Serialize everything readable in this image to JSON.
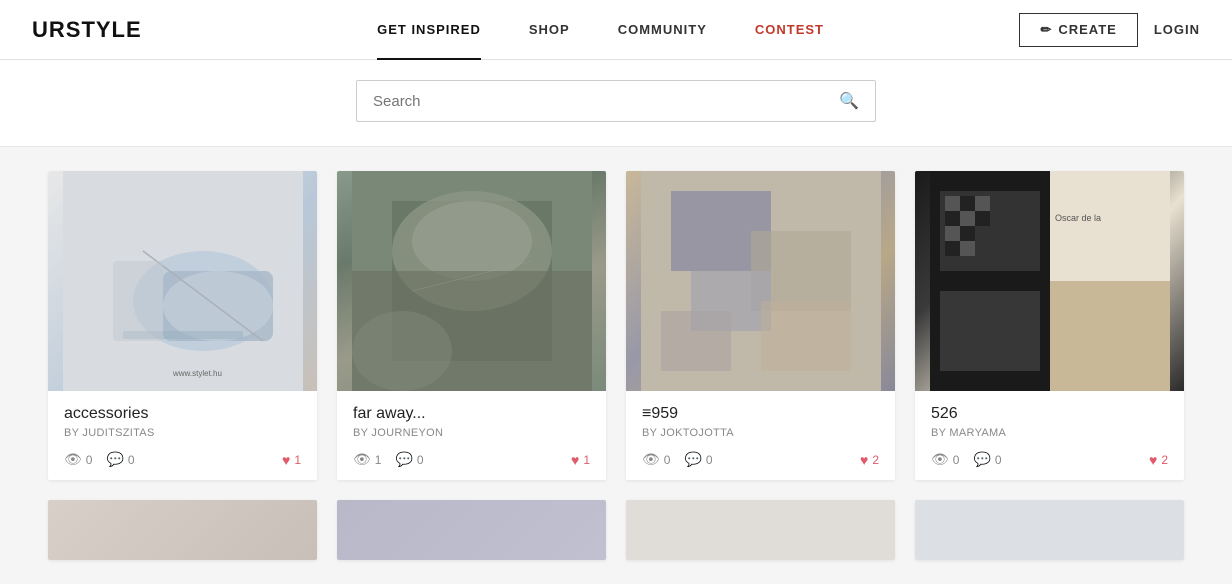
{
  "logo": "URSTYLE",
  "nav": {
    "items": [
      {
        "id": "get-inspired",
        "label": "GET INSPIRED",
        "active": true
      },
      {
        "id": "shop",
        "label": "SHOP",
        "active": false
      },
      {
        "id": "community",
        "label": "COMMUNITY",
        "active": false
      },
      {
        "id": "contest",
        "label": "CONTEST",
        "active": false,
        "highlight": true
      }
    ]
  },
  "header": {
    "create_label": "CREATE",
    "login_label": "LOGIN"
  },
  "search": {
    "placeholder": "Search"
  },
  "cards": [
    {
      "title": "accessories",
      "author": "by JUDITSZITAS",
      "views": "0",
      "comments": "0",
      "likes": "1",
      "img_class": "card-img-1"
    },
    {
      "title": "far away...",
      "author": "by JOURNEYON",
      "views": "1",
      "comments": "0",
      "likes": "1",
      "img_class": "card-img-2"
    },
    {
      "title": "≡959",
      "author": "by JOKTOJOTTA",
      "views": "0",
      "comments": "0",
      "likes": "2",
      "img_class": "card-img-3"
    },
    {
      "title": "526",
      "author": "by MARYAMA",
      "views": "0",
      "comments": "0",
      "likes": "2",
      "img_class": "card-img-4"
    }
  ],
  "bottom_cards": [
    {
      "img_class": "card-img-bottom-1"
    },
    {
      "img_class": "card-img-bottom-2"
    },
    {
      "img_class": "card-img-bottom-3"
    },
    {
      "img_class": "card-img-bottom-4"
    }
  ]
}
